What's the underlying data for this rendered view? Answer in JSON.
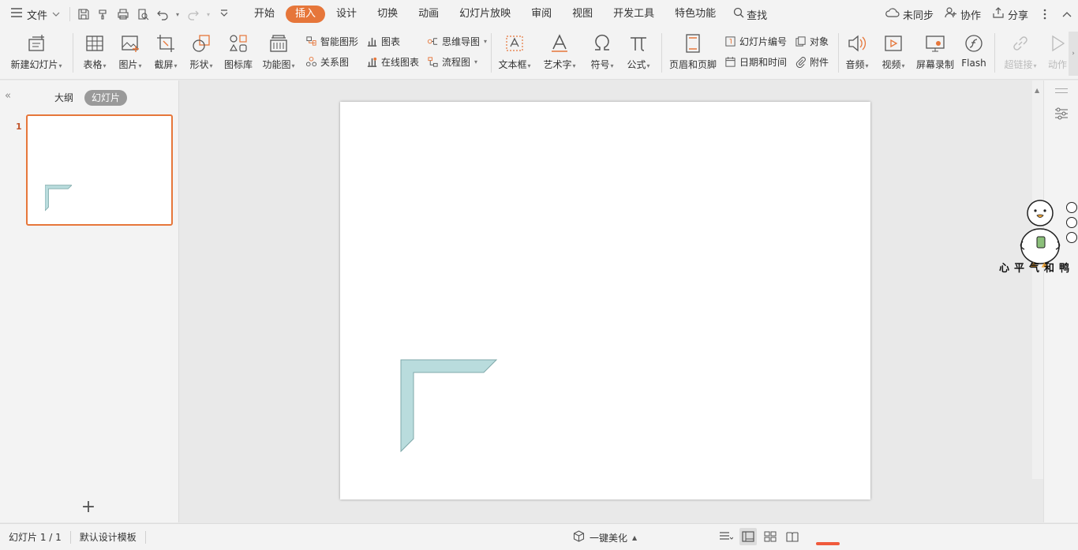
{
  "menu": {
    "file_label": "文件",
    "tabs": [
      {
        "label": "开始",
        "active": false
      },
      {
        "label": "插入",
        "active": true
      },
      {
        "label": "设计",
        "active": false
      },
      {
        "label": "切换",
        "active": false
      },
      {
        "label": "动画",
        "active": false
      },
      {
        "label": "幻灯片放映",
        "active": false
      },
      {
        "label": "审阅",
        "active": false
      },
      {
        "label": "视图",
        "active": false
      },
      {
        "label": "开发工具",
        "active": false
      },
      {
        "label": "特色功能",
        "active": false
      }
    ],
    "search_label": "查找",
    "sync_label": "未同步",
    "collab_label": "协作",
    "share_label": "分享"
  },
  "ribbon": {
    "new_slide": "新建幻灯片",
    "table": "表格",
    "picture": "图片",
    "screenshot": "截屏",
    "shape": "形状",
    "icon_library": "图标库",
    "function_chart": "功能图",
    "smart_art": "智能图形",
    "chart": "图表",
    "relation": "关系图",
    "online_chart": "在线图表",
    "mind_map": "思维导图",
    "flow_chart": "流程图",
    "text_box": "文本框",
    "word_art": "艺术字",
    "symbol": "符号",
    "formula": "公式",
    "header_footer": "页眉和页脚",
    "slide_number": "幻灯片编号",
    "object": "对象",
    "date_time": "日期和时间",
    "attachment": "附件",
    "audio": "音频",
    "video": "视频",
    "screen_record": "屏幕录制",
    "flash": "Flash",
    "hyperlink": "超链接",
    "action": "动作"
  },
  "left_panel": {
    "outline_tab": "大纲",
    "slides_tab": "幻灯片",
    "slide_number": "1"
  },
  "watermark": {
    "text": "心平气和鸭"
  },
  "status": {
    "slide_info": "幻灯片 1 / 1",
    "template": "默认设计模板",
    "beautify": "一键美化"
  },
  "colors": {
    "accent": "#e6763a",
    "shape_fill": "#b9dcdd",
    "shape_stroke": "#7fa9aa"
  }
}
